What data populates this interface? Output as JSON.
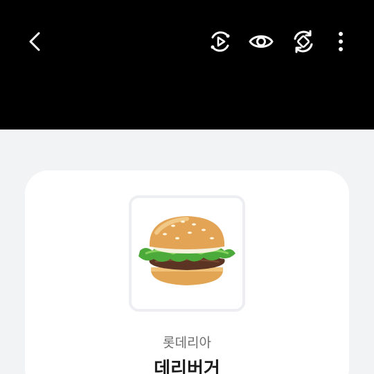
{
  "toolbar": {
    "back_icon": "chevron-left-icon",
    "motion_icon": "motion-photo-play-icon",
    "view_icon": "eye-icon",
    "rotate_icon": "rotate-icon",
    "more_icon": "more-vertical-icon"
  },
  "product": {
    "brand": "롯데리아",
    "name": "데리버거",
    "image": "burger-image"
  },
  "colors": {
    "topbar": "#000000",
    "background": "#f2f3f5",
    "card": "#ffffff"
  }
}
